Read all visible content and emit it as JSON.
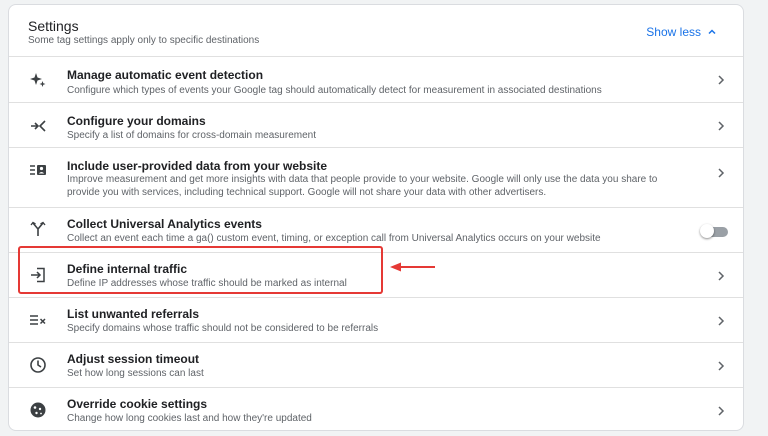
{
  "header": {
    "title": "Settings",
    "subtitle": "Some tag settings apply only to specific destinations",
    "toggle_label": "Show less"
  },
  "rows": [
    {
      "icon": "sparkle-icon",
      "title": "Manage automatic event detection",
      "desc": "Configure which types of events your Google tag should automatically detect for measurement in associated destinations"
    },
    {
      "icon": "domain-merge-icon",
      "title": "Configure your domains",
      "desc": "Specify a list of domains for cross-domain measurement"
    },
    {
      "icon": "user-data-list-icon",
      "title": "Include user-provided data from your website",
      "desc": "Improve measurement and get more insights with data that people provide to your website. Google will only use the data you share to provide you with services, including technical support. Google will not share your data with other advertisers."
    },
    {
      "icon": "fork-icon",
      "title": "Collect Universal Analytics events",
      "desc": "Collect an event each time a ga() custom event, timing, or exception call from Universal Analytics occurs on your website",
      "toggle": false
    },
    {
      "icon": "login-icon",
      "title": "Define internal traffic",
      "desc": "Define IP addresses whose traffic should be marked as internal"
    },
    {
      "icon": "list-remove-icon",
      "title": "List unwanted referrals",
      "desc": "Specify domains whose traffic should not be considered to be referrals"
    },
    {
      "icon": "clock-icon",
      "title": "Adjust session timeout",
      "desc": "Set how long sessions can last"
    },
    {
      "icon": "cookie-icon",
      "title": "Override cookie settings",
      "desc": "Change how long cookies last and how they're updated"
    }
  ],
  "colors": {
    "accent": "#1a73e8",
    "highlight": "#e53935"
  }
}
